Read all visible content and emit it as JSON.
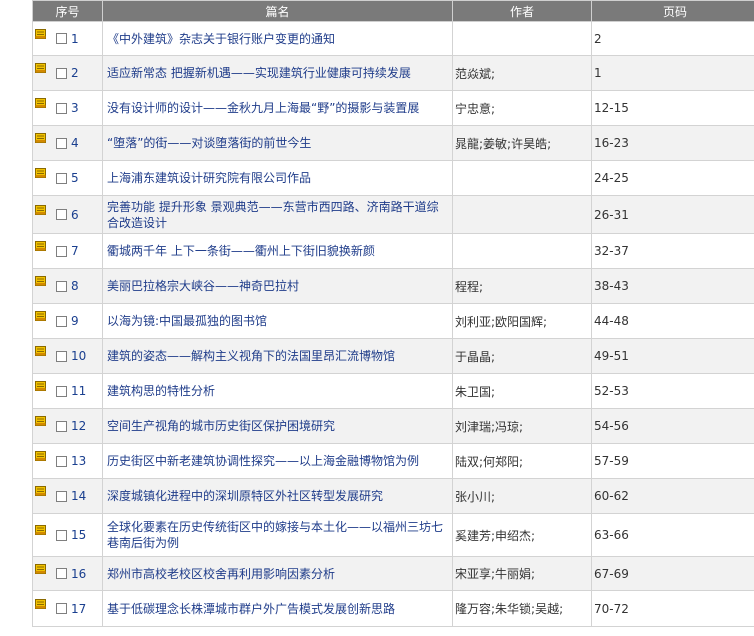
{
  "table": {
    "headers": {
      "seq": "序号",
      "title": "篇名",
      "author": "作者",
      "pages": "页码"
    },
    "rows": [
      {
        "num": "1",
        "title": "《中外建筑》杂志关于银行账户变更的通知",
        "author": "",
        "pages": "2"
      },
      {
        "num": "2",
        "title": "适应新常态 把握新机遇——实现建筑行业健康可持续发展",
        "author": "范焱斌;",
        "pages": "1"
      },
      {
        "num": "3",
        "title": "没有设计师的设计——金秋九月上海最“野”的摄影与装置展",
        "author": "宁忠意;",
        "pages": "12-15"
      },
      {
        "num": "4",
        "title": "“堕落”的街——对谈堕落街的前世今生",
        "author": "晁龍;姜敏;许昊皓;",
        "pages": "16-23"
      },
      {
        "num": "5",
        "title": "上海浦东建筑设计研究院有限公司作品",
        "author": "",
        "pages": "24-25"
      },
      {
        "num": "6",
        "title": "完善功能 提升形象 景观典范——东营市西四路、济南路干道综合改造设计",
        "author": "",
        "pages": "26-31"
      },
      {
        "num": "7",
        "title": "衢城两千年 上下一条街——衢州上下街旧貌换新颜",
        "author": "",
        "pages": "32-37"
      },
      {
        "num": "8",
        "title": "美丽巴拉格宗大峡谷——神奇巴拉村",
        "author": "程程;",
        "pages": "38-43"
      },
      {
        "num": "9",
        "title": "以海为镜:中国最孤独的图书馆",
        "author": "刘利亚;欧阳国辉;",
        "pages": "44-48"
      },
      {
        "num": "10",
        "title": "建筑的姿态——解构主义视角下的法国里昂汇流博物馆",
        "author": "于晶晶;",
        "pages": "49-51"
      },
      {
        "num": "11",
        "title": "建筑构思的特性分析",
        "author": "朱卫国;",
        "pages": "52-53"
      },
      {
        "num": "12",
        "title": "空间生产视角的城市历史街区保护困境研究",
        "author": "刘津瑞;冯琼;",
        "pages": "54-56"
      },
      {
        "num": "13",
        "title": "历史街区中新老建筑协调性探究——以上海金融博物馆为例",
        "author": "陆双;何郑阳;",
        "pages": "57-59"
      },
      {
        "num": "14",
        "title": "深度城镇化进程中的深圳原特区外社区转型发展研究",
        "author": "张小川;",
        "pages": "60-62"
      },
      {
        "num": "15",
        "title": "全球化要素在历史传统街区中的嫁接与本土化——以福州三坊七巷南后街为例",
        "author": "奚建芳;申绍杰;",
        "pages": "63-66"
      },
      {
        "num": "16",
        "title": "郑州市高校老校区校舍再利用影响因素分析",
        "author": "宋亚享;牛丽娟;",
        "pages": "67-69"
      },
      {
        "num": "17",
        "title": "基于低碳理念长株潭城市群户外广告模式发展创新思路",
        "author": "隆万容;朱华锁;吴越;",
        "pages": "70-72"
      }
    ]
  },
  "colors": {
    "header_bg": "#7a7a7a",
    "link": "#1f3c8a",
    "icon": "#e8b400",
    "row_alt": "#f2f2f2"
  },
  "icons": {
    "doc": "document-icon"
  }
}
